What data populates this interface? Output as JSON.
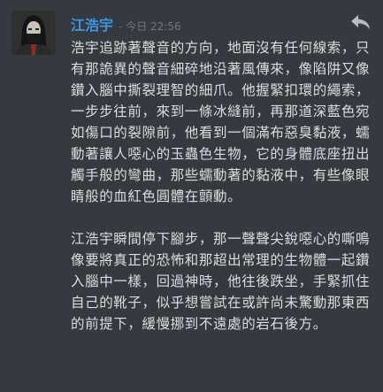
{
  "message": {
    "author": "江浩宇",
    "separator": "-",
    "timestamp": "今日 22:56",
    "paragraphs": [
      "浩宇追跡著聲音的方向，地面沒有任何線索，只有那詭異的聲音細碎地沿著風傳來，像陷阱又像鑽入腦中撕裂理智的細爪。他握緊扣環的繩索，一步步往前，來到一條冰縫前，再那道深藍色宛如傷口的裂隙前，他看到一個滿布惡臭黏液，蠕動著讓人噁心的玉蟲色生物，它的身體底座扭出觸手般的彎曲，那些蠕動著的黏液中，有些像眼睛般的血紅色圓體在顫動。",
      "江浩宇瞬間停下腳步，那一聲聲尖銳噁心的嘶鳴像要將真正的恐怖和那超出常理的生物體一起鑽入腦中一樣，回過神時，他往後跌坐，手緊抓住自己的靴子，似乎想嘗試在或許尚未驚動那東西的前提下，緩慢挪到不遠處的岩石後方。"
    ]
  },
  "icons": {
    "reply": "reply-arrow-icon",
    "avatar": "masked-figure-avatar"
  },
  "colors": {
    "background": "#36393f",
    "username": "#3a97e6",
    "text": "#dcddde",
    "timestamp": "#72767d"
  }
}
